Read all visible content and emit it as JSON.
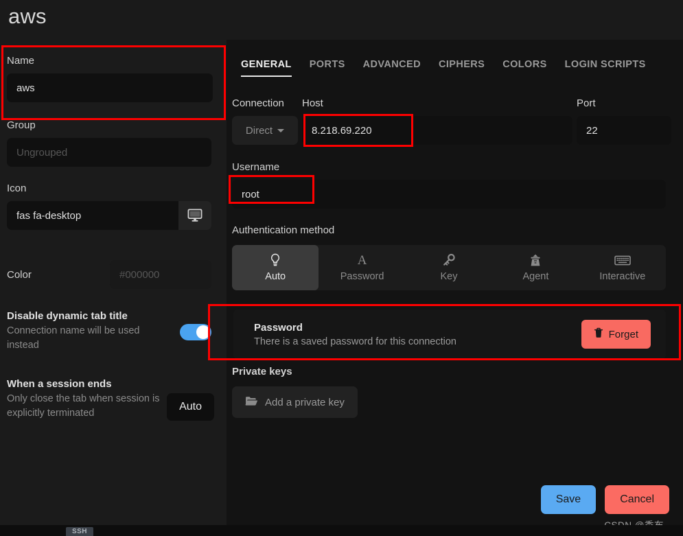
{
  "header": {
    "title": "aws"
  },
  "left": {
    "name": {
      "label": "Name",
      "value": "aws"
    },
    "group": {
      "label": "Group",
      "placeholder": "Ungrouped",
      "value": ""
    },
    "icon": {
      "label": "Icon",
      "value": "fas fa-desktop",
      "preview_icon": "desktop-icon"
    },
    "color": {
      "label": "Color",
      "placeholder": "#000000",
      "value": ""
    },
    "dynamic_tab": {
      "title": "Disable dynamic tab title",
      "description": "Connection name will be used instead",
      "toggle_on": true
    },
    "session_ends": {
      "title": "When a session ends",
      "description": "Only close the tab when session is explicitly terminated",
      "button_label": "Auto"
    }
  },
  "tabs": [
    {
      "label": "GENERAL",
      "active": true
    },
    {
      "label": "PORTS",
      "active": false
    },
    {
      "label": "ADVANCED",
      "active": false
    },
    {
      "label": "CIPHERS",
      "active": false
    },
    {
      "label": "COLORS",
      "active": false
    },
    {
      "label": "LOGIN SCRIPTS",
      "active": false
    }
  ],
  "general": {
    "connection_label": "Connection",
    "connection_value": "Direct",
    "host_label": "Host",
    "host_value": "8.218.69.220",
    "port_label": "Port",
    "port_value": "22",
    "username_label": "Username",
    "username_value": "root",
    "auth_label": "Authentication method",
    "auth_methods": [
      {
        "label": "Auto",
        "icon": "lightbulb-icon",
        "selected": true
      },
      {
        "label": "Password",
        "icon": "letter-a-icon",
        "selected": false
      },
      {
        "label": "Key",
        "icon": "key-icon",
        "selected": false
      },
      {
        "label": "Agent",
        "icon": "user-secret-icon",
        "selected": false
      },
      {
        "label": "Interactive",
        "icon": "keyboard-icon",
        "selected": false
      }
    ],
    "password": {
      "title": "Password",
      "description": "There is a saved password for this connection",
      "forget_label": "Forget",
      "forget_icon": "trash-icon"
    },
    "private_keys": {
      "label": "Private keys",
      "add_label": "Add a private key",
      "add_icon": "folder-open-icon"
    }
  },
  "footer": {
    "save_label": "Save",
    "cancel_label": "Cancel",
    "watermark": "CSDN @季布，"
  },
  "bottom_bar": {
    "ssh_tab_label": "SSH"
  },
  "colors": {
    "accent_blue": "#5aaaf2",
    "danger_red": "#fb6b62",
    "annotation_red": "#fe0000",
    "panel_left": "#1b1b1b",
    "panel_right": "#131313"
  }
}
